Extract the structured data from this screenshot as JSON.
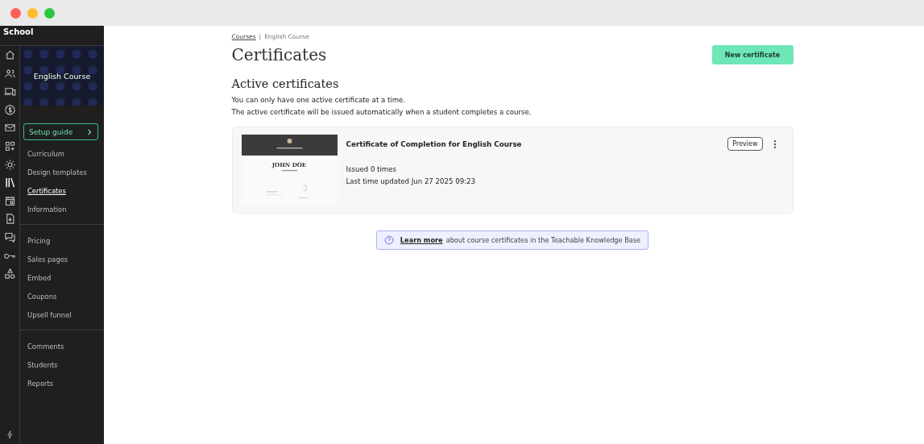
{
  "school": {
    "name": "School"
  },
  "rail": [
    {
      "selected": false
    },
    {
      "selected": false
    },
    {
      "selected": false
    },
    {
      "selected": false
    },
    {
      "selected": false
    },
    {
      "selected": false
    },
    {
      "selected": false
    },
    {
      "selected": true
    },
    {
      "selected": false
    },
    {
      "selected": false
    },
    {
      "selected": false
    },
    {
      "selected": false
    },
    {
      "selected": false
    }
  ],
  "course": {
    "title": "English Course",
    "setup_guide": "Setup guide"
  },
  "nav_groups": [
    [
      {
        "label": "Curriculum",
        "selected": false
      },
      {
        "label": "Design templates",
        "selected": false
      },
      {
        "label": "Certificates",
        "selected": true
      },
      {
        "label": "Information",
        "selected": false
      }
    ],
    [
      {
        "label": "Pricing",
        "selected": false
      },
      {
        "label": "Sales pages",
        "selected": false
      },
      {
        "label": "Embed",
        "selected": false
      },
      {
        "label": "Coupons",
        "selected": false
      },
      {
        "label": "Upsell funnel",
        "selected": false
      }
    ],
    [
      {
        "label": "Comments",
        "selected": false
      },
      {
        "label": "Students",
        "selected": false
      },
      {
        "label": "Reports",
        "selected": false
      }
    ]
  ],
  "breadcrumb": {
    "link": "Courses",
    "separator": "|",
    "current": "English Course"
  },
  "page_title": "Certificates",
  "new_button": "New certificate",
  "section": {
    "title": "Active certificates",
    "lines": [
      "You can only have one active certificate at a time.",
      "The active certificate will be issued automatically when a student completes a course."
    ]
  },
  "certificate": {
    "title": "Certificate of Completion for English Course",
    "thumbnail_name": "JOHN DOE",
    "issued": "Issued 0 times",
    "updated": "Last time updated Jun 27 2025 09:23",
    "preview": "Preview"
  },
  "info": {
    "link": "Learn more",
    "text": "about course certificates in the Teachable Knowledge Base"
  }
}
